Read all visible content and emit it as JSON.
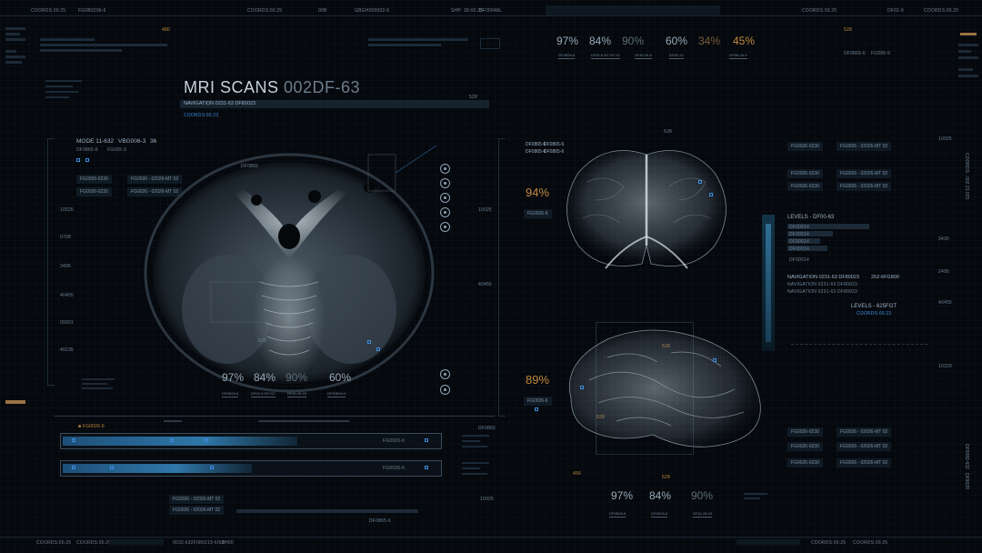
{
  "header": {
    "title": "MRI SCANS",
    "code": "002DF-63",
    "navigation": "NAVIGATION 0231-63  DF80023",
    "coords_sub": "COORDS:00.23",
    "top_strip": [
      "COORDS:00.25",
      "FG0B0296-6",
      "COORDS:00.25",
      "00B",
      "GBGH000002-6",
      "SHP: 28:00.25",
      "DF000",
      "48L",
      "COORDS:00.25",
      "DF02-9",
      "COORDS:00.25"
    ],
    "top_right_label": "528",
    "top_left_label": "480"
  },
  "left_panel": {
    "mode": "MODE 11-632",
    "mode_code": "VBG006-3",
    "mode_num": "36",
    "sub_codes": [
      "DF0865-6",
      "FG065-9"
    ],
    "rows": [
      [
        "FG0026-0230",
        "FG0026 - 02026-MT  02"
      ],
      [
        "FG0026-0230",
        "FG0026 - 02026-MT  02"
      ]
    ],
    "side_numbers": [
      "10025",
      "0708",
      "3495",
      "40455",
      "09201",
      "40235"
    ]
  },
  "axial_stats": {
    "values": [
      "97%",
      "84%",
      "90%",
      "60%"
    ],
    "subs": [
      "DF0B28-6",
      "DF02-9 MT-NT",
      "DF40.28-03",
      "DF60B94-6"
    ],
    "label_528": "528"
  },
  "top_stats": {
    "values": [
      "97%",
      "84%",
      "90%",
      "60%",
      "34%",
      "45%"
    ],
    "subs": [
      "DF0B28-6",
      "DF60-6 NT-NT  02",
      "DF40.28-6",
      "DF60-13",
      "DF6B-26-9"
    ]
  },
  "coronal": {
    "percent": "94%",
    "label": "FG0026-6",
    "top_label": "528",
    "codes": [
      "DF0865-6",
      "DF0865-6",
      "DF0865-6",
      "DF0865-6"
    ]
  },
  "sagittal": {
    "percent": "89%",
    "label": "FG0026-6",
    "top_label": "528",
    "bottom_label": "528",
    "mid_label": "528",
    "side_num": "456"
  },
  "right_panel": {
    "top_label": "528",
    "codes": [
      "DF0865-6",
      "FG065-9"
    ],
    "rows": [
      [
        "FG0026-0230",
        "FG0026 - 02026-MT  02"
      ],
      [
        "FG0026-0230",
        "FG0026 - 02026-MT  02"
      ],
      [
        "FG0026-0230",
        "FG0026 - 02026-MT  02"
      ]
    ],
    "levels_title": "LEVELS - DF00-63",
    "level_rows": [
      "DF00914",
      "DF00914",
      "DF00914",
      "DF00914",
      "DF00914"
    ],
    "nav_title": "NAVIGATION 0231-63  DF80023",
    "nav_code": "252-6FG800",
    "nav_sub": [
      "NAVIGATION 0231-63  DF80023",
      "NAVIGATION 0231-63  DF80023"
    ],
    "levels2": "LEVELS - 625FGT",
    "levels2_coords": "COORDS:00.23",
    "bottom_rows": [
      [
        "FG0026-0230",
        "FG0026 - 02026-MT  02"
      ],
      [
        "FG0026-0230",
        "FG0026 - 02026-MT  02"
      ],
      [
        "FG0026-0230",
        "FG0026 - 02026-MT  02"
      ]
    ],
    "side_numbers": [
      "10025",
      "3430",
      "2495",
      "40455",
      "10229"
    ],
    "vertical_text": "COORDS : 002.23.023",
    "vertical_text2": "DF0082-632",
    "vertical_text3": "DF9028"
  },
  "bottom": {
    "stats": [
      "97%",
      "84%",
      "90%"
    ],
    "stat_subs": [
      "DF0B28-6",
      "DF0B28-6",
      "DF40.28-03"
    ],
    "strip": [
      "COORDS:00.25",
      "COORDS:00.25",
      "0032-632F08",
      "0219-6/93",
      "8H00",
      "COORDS:00.25",
      "COORDS:00.25"
    ],
    "progress1": 0.62,
    "progress2": 0.5,
    "progress_label": "FG0026-6"
  },
  "colors": {
    "accent_blue": "#3d8ee0",
    "orange": "#c3893f",
    "text": "#9aaab8"
  }
}
